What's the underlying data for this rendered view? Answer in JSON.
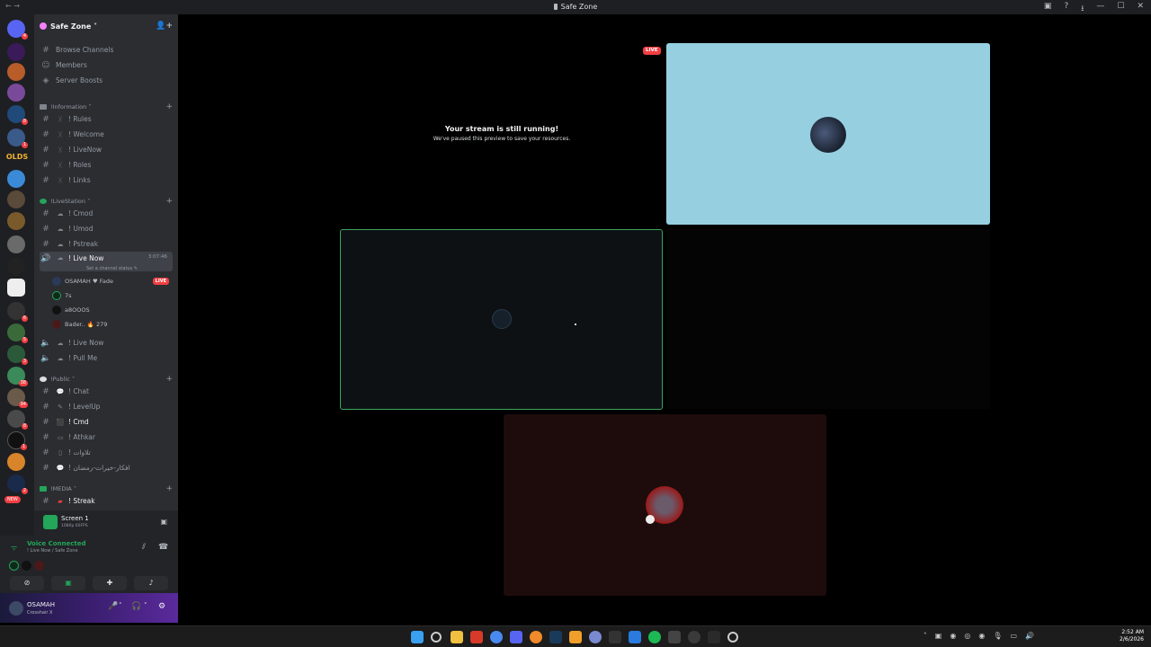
{
  "window": {
    "title": "Safe Zone",
    "nav_back": "←",
    "nav_forward": "→",
    "icons": [
      "inbox-icon",
      "help-icon",
      "download-icon",
      "minimize-icon",
      "maximize-icon",
      "close-icon"
    ],
    "icon_glyphs": [
      "▣",
      "?",
      "⭳",
      "—",
      "☐",
      "✕"
    ]
  },
  "server_rail": {
    "olds_label": "OLDS",
    "new_badge": "NEW",
    "badges": [
      "4",
      "8",
      "1",
      "6",
      "5",
      "3",
      "38",
      "94",
      "8",
      "1",
      "2"
    ]
  },
  "sidebar": {
    "server_name": "Safe Zone",
    "top_items": [
      {
        "label": "Browse Channels",
        "icon": "#"
      },
      {
        "label": "Members",
        "icon": "👥"
      },
      {
        "label": "Server Boosts",
        "icon": "◈"
      }
    ],
    "categories": {
      "information": "Information",
      "livestation": "LiveStation",
      "public": "Public",
      "media": "MEDIA"
    },
    "info_channels": [
      "Rules",
      "Welcome",
      "LiveNow",
      "Roles",
      "Links"
    ],
    "livestation_channels": [
      "Cmod",
      "Umod",
      "Pstreak"
    ],
    "live_now_channel": "Live Now",
    "live_now_time": "3:07:46",
    "set_status": "Set a channel status ✎",
    "voice_users": [
      {
        "name": "OSAMAH",
        "extra": "♥ Fade",
        "live": "LIVE",
        "color": "#2a3a5a"
      },
      {
        "name": "7s",
        "extra": "",
        "live": "",
        "color": "#0f2a1a"
      },
      {
        "name": "a8OOOS",
        "extra": "",
        "live": "",
        "color": "#111"
      },
      {
        "name": "Bader..",
        "extra": "🔥 279",
        "live": "",
        "color": "#4a1a1a"
      }
    ],
    "voice_channels_more": [
      "Live Now",
      "Pull Me"
    ],
    "public_channels": [
      "Chat",
      "LevelUp",
      "Cmd",
      "Athkar",
      "تلاوات",
      "افكار-خيرات-رمضان"
    ],
    "media_channels": [
      "Streak"
    ],
    "prefix": "!"
  },
  "screen_share": {
    "title": "Screen 1",
    "subtitle": "1080p 60FPS"
  },
  "voice": {
    "status": "Voice Connected",
    "location": "! Live Now / Safe Zone",
    "avatar_colors": [
      "#0f2a1a",
      "#111111",
      "#4a1a1a"
    ],
    "buttons": [
      "camera-off",
      "screen-share",
      "activities",
      "soundboard"
    ],
    "button_glyphs": [
      "⊘",
      "▣",
      "✚",
      "♪"
    ]
  },
  "user": {
    "name": "OSAMAH",
    "status": "Crosshair X",
    "controls": [
      "🎤",
      "˅",
      "🎧",
      "˅",
      "⚙"
    ]
  },
  "stage": {
    "paused_title": "Your stream is still running!",
    "paused_text": "We've paused this preview to save your resources.",
    "live_label": "LIVE",
    "tile_colors": {
      "top_right": "#96d0e0",
      "middle_left": "#0d1114",
      "middle_right": "#040404",
      "bottom": "#1e0c0c",
      "border_speaking": "#3ba55d"
    }
  },
  "taskbar": {
    "time": "2:52 AM",
    "date": "2/6/2026"
  }
}
